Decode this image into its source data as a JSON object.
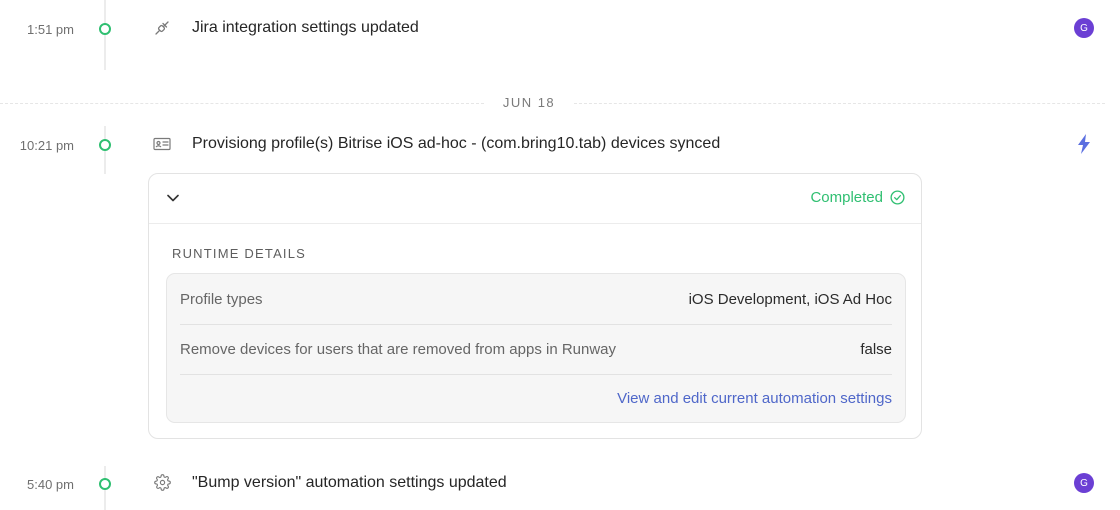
{
  "events": [
    {
      "time": "1:51 pm",
      "title": "Jira integration settings updated",
      "icon": "plug-icon",
      "actor": {
        "type": "avatar",
        "initial": "G",
        "color": "#6b3fd4"
      }
    },
    {
      "time": "10:21 pm",
      "title": "Provisiong profile(s) Bitrise iOS ad-hoc - (com.bring10.tab) devices synced",
      "icon": "id-card-icon",
      "actor": {
        "type": "automation",
        "icon": "bolt-icon",
        "color": "#5b6fe0"
      }
    },
    {
      "time": "5:40 pm",
      "title": "\"Bump version\" automation settings updated",
      "icon": "gear-icon",
      "actor": {
        "type": "avatar",
        "initial": "G",
        "color": "#6b3fd4"
      }
    }
  ],
  "date_separator": "JUN 18",
  "card": {
    "status": "Completed",
    "status_color": "#2fbf71",
    "section_label": "RUNTIME DETAILS",
    "details": [
      {
        "key": "Profile types",
        "value": "iOS Development, iOS Ad Hoc"
      },
      {
        "key": "Remove devices for users that are removed from apps in Runway",
        "value": "false"
      }
    ],
    "link_label": "View and edit current automation settings"
  }
}
